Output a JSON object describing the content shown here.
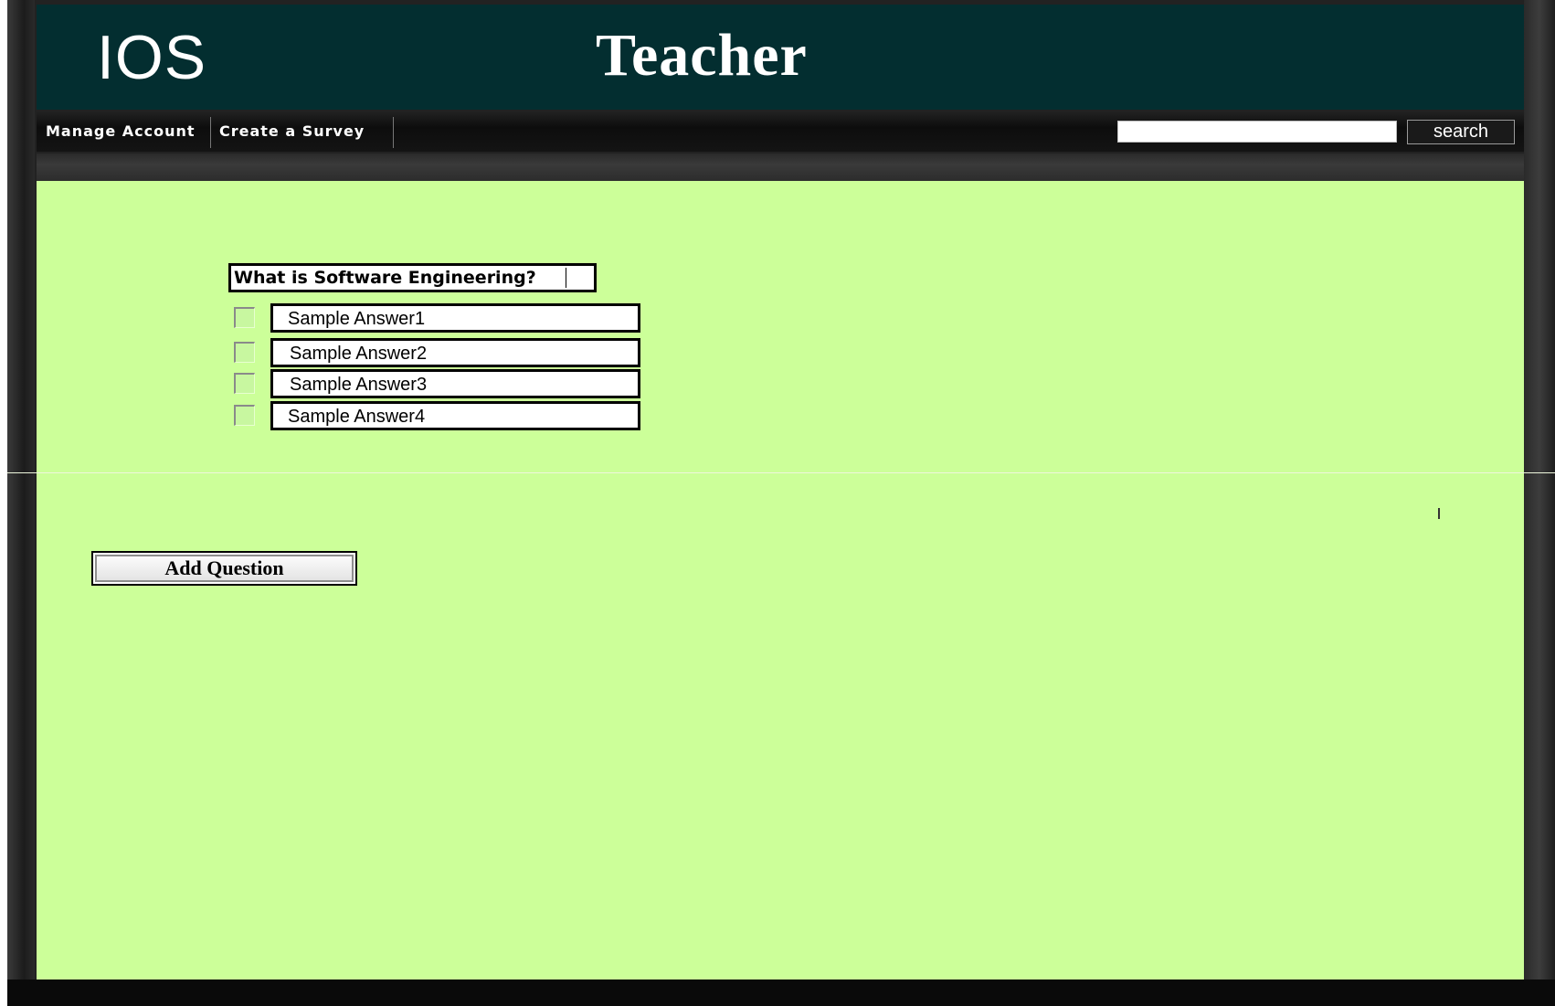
{
  "header": {
    "logo_text": "IOS",
    "title": "Teacher"
  },
  "nav": {
    "items": [
      {
        "label": "Manage Account"
      },
      {
        "label": "Create a Survey"
      }
    ],
    "search": {
      "placeholder": "",
      "value": "",
      "button_label": "search"
    }
  },
  "survey": {
    "question": "What is Software Engineering?",
    "answers": [
      {
        "label": "Sample Answer1",
        "checked": false
      },
      {
        "label": "Sample Answer2",
        "checked": false
      },
      {
        "label": "Sample Answer3",
        "checked": false
      },
      {
        "label": "Sample Answer4",
        "checked": false
      }
    ],
    "add_question_label": "Add Question"
  },
  "colors": {
    "header_bg": "#032e30",
    "content_bg": "#ccff99",
    "navbar_bg": "#0d0d0d"
  }
}
